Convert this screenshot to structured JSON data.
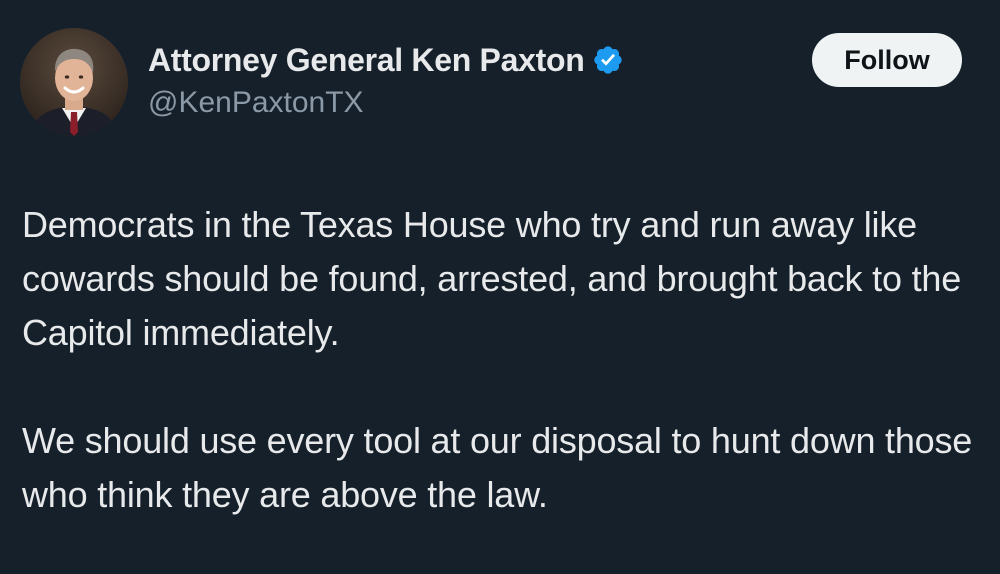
{
  "author": {
    "display_name": "Attorney General Ken Paxton",
    "handle": "@KenPaxtonTX",
    "verified_icon": "verified-badge-icon",
    "verified_color": "#1d9bf0"
  },
  "follow_button": {
    "label": "Follow"
  },
  "tweet": {
    "paragraphs": [
      "Democrats in the Texas House who try and run away like cowards should be found, arrested, and brought back to the Capitol immediately.",
      "We should use every tool at our disposal to hunt down those who think they are above the law."
    ]
  },
  "colors": {
    "background": "#15202b",
    "text_primary": "#e7e9ea",
    "text_secondary": "#8b98a5",
    "button_bg": "#eff3f4"
  }
}
